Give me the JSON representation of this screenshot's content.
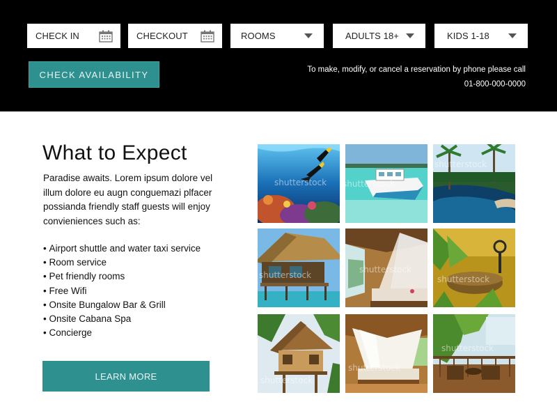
{
  "booking": {
    "check_in_label": "CHECK IN",
    "checkout_label": "CHECKOUT",
    "rooms_label": "ROOMS",
    "adults_label": "ADULTS 18+",
    "kids_label": "KIDS 1-18",
    "check_availability_label": "CHECK AVAILABILITY",
    "phone_note_line1": "To make, modify, or cancel a reservation by phone please call",
    "phone_number": "01-800-000-0000"
  },
  "content": {
    "title": "What to Expect",
    "intro": "Paradise awaits. Lorem ipsum dolore vel illum dolore eu augn conguemazi plfacer possianda friendly staff guests will enjoy convieniences such as:",
    "amenities": [
      "Airport shuttle and water taxi service",
      "Room service",
      "Pet friendly rooms",
      "Free Wifi",
      "Onsite Bungalow Bar & Grill",
      "Onsite Cabana Spa",
      "Concierge"
    ],
    "learn_more_label": "LEARN MORE"
  },
  "gallery": {
    "watermark": "shutterstock",
    "photos": [
      "underwater-diver-coral-photo",
      "boat-turquoise-water-photo",
      "resort-pool-palms-photo",
      "thatched-overwater-hut-photo",
      "bungalow-bed-mosquito-net-photo",
      "bamboo-basket-decor-photo",
      "bamboo-treehouse-photo",
      "canopy-bed-thatched-room-photo",
      "terrace-chairs-greenery-photo"
    ]
  },
  "colors": {
    "bar_background": "#000000",
    "accent_teal": "#2f9090",
    "page_background": "#ffffff"
  }
}
